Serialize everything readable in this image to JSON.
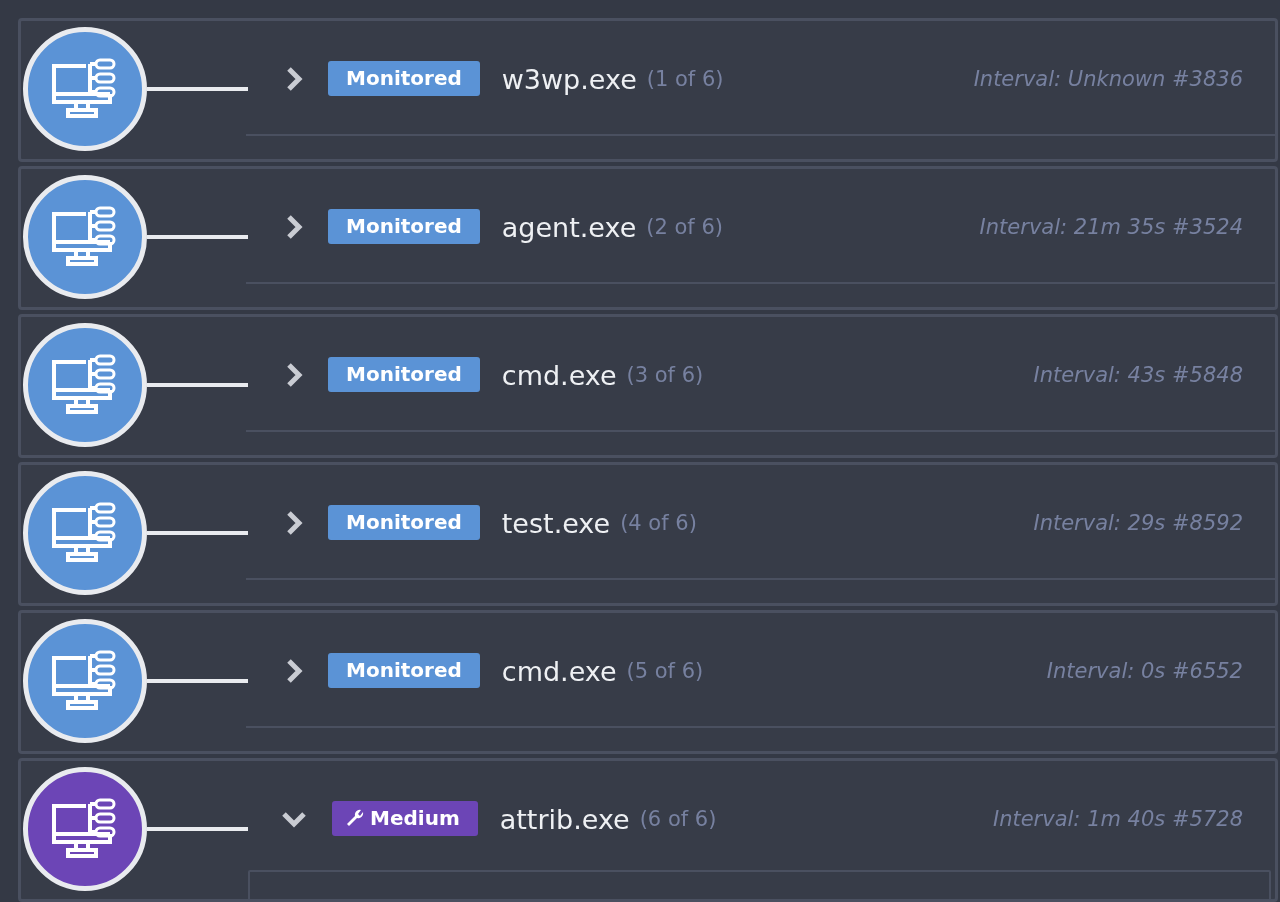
{
  "processes": [
    {
      "badge": {
        "kind": "monitored",
        "label": "Monitored"
      },
      "name": "w3wp.exe",
      "count": "(1 of 6)",
      "interval": "Interval: Unknown #3836",
      "expanded": false
    },
    {
      "badge": {
        "kind": "monitored",
        "label": "Monitored"
      },
      "name": "agent.exe",
      "count": "(2 of 6)",
      "interval": "Interval: 21m 35s #3524",
      "expanded": false
    },
    {
      "badge": {
        "kind": "monitored",
        "label": "Monitored"
      },
      "name": "cmd.exe",
      "count": "(3 of 6)",
      "interval": "Interval: 43s #5848",
      "expanded": false
    },
    {
      "badge": {
        "kind": "monitored",
        "label": "Monitored"
      },
      "name": "test.exe",
      "count": "(4 of 6)",
      "interval": "Interval: 29s #8592",
      "expanded": false
    },
    {
      "badge": {
        "kind": "monitored",
        "label": "Monitored"
      },
      "name": "cmd.exe",
      "count": "(5 of 6)",
      "interval": "Interval: 0s #6552",
      "expanded": false
    },
    {
      "badge": {
        "kind": "medium",
        "label": "Medium"
      },
      "name": "attrib.exe",
      "count": "(6 of 6)",
      "interval": "Interval: 1m 40s #5728",
      "expanded": true
    }
  ]
}
